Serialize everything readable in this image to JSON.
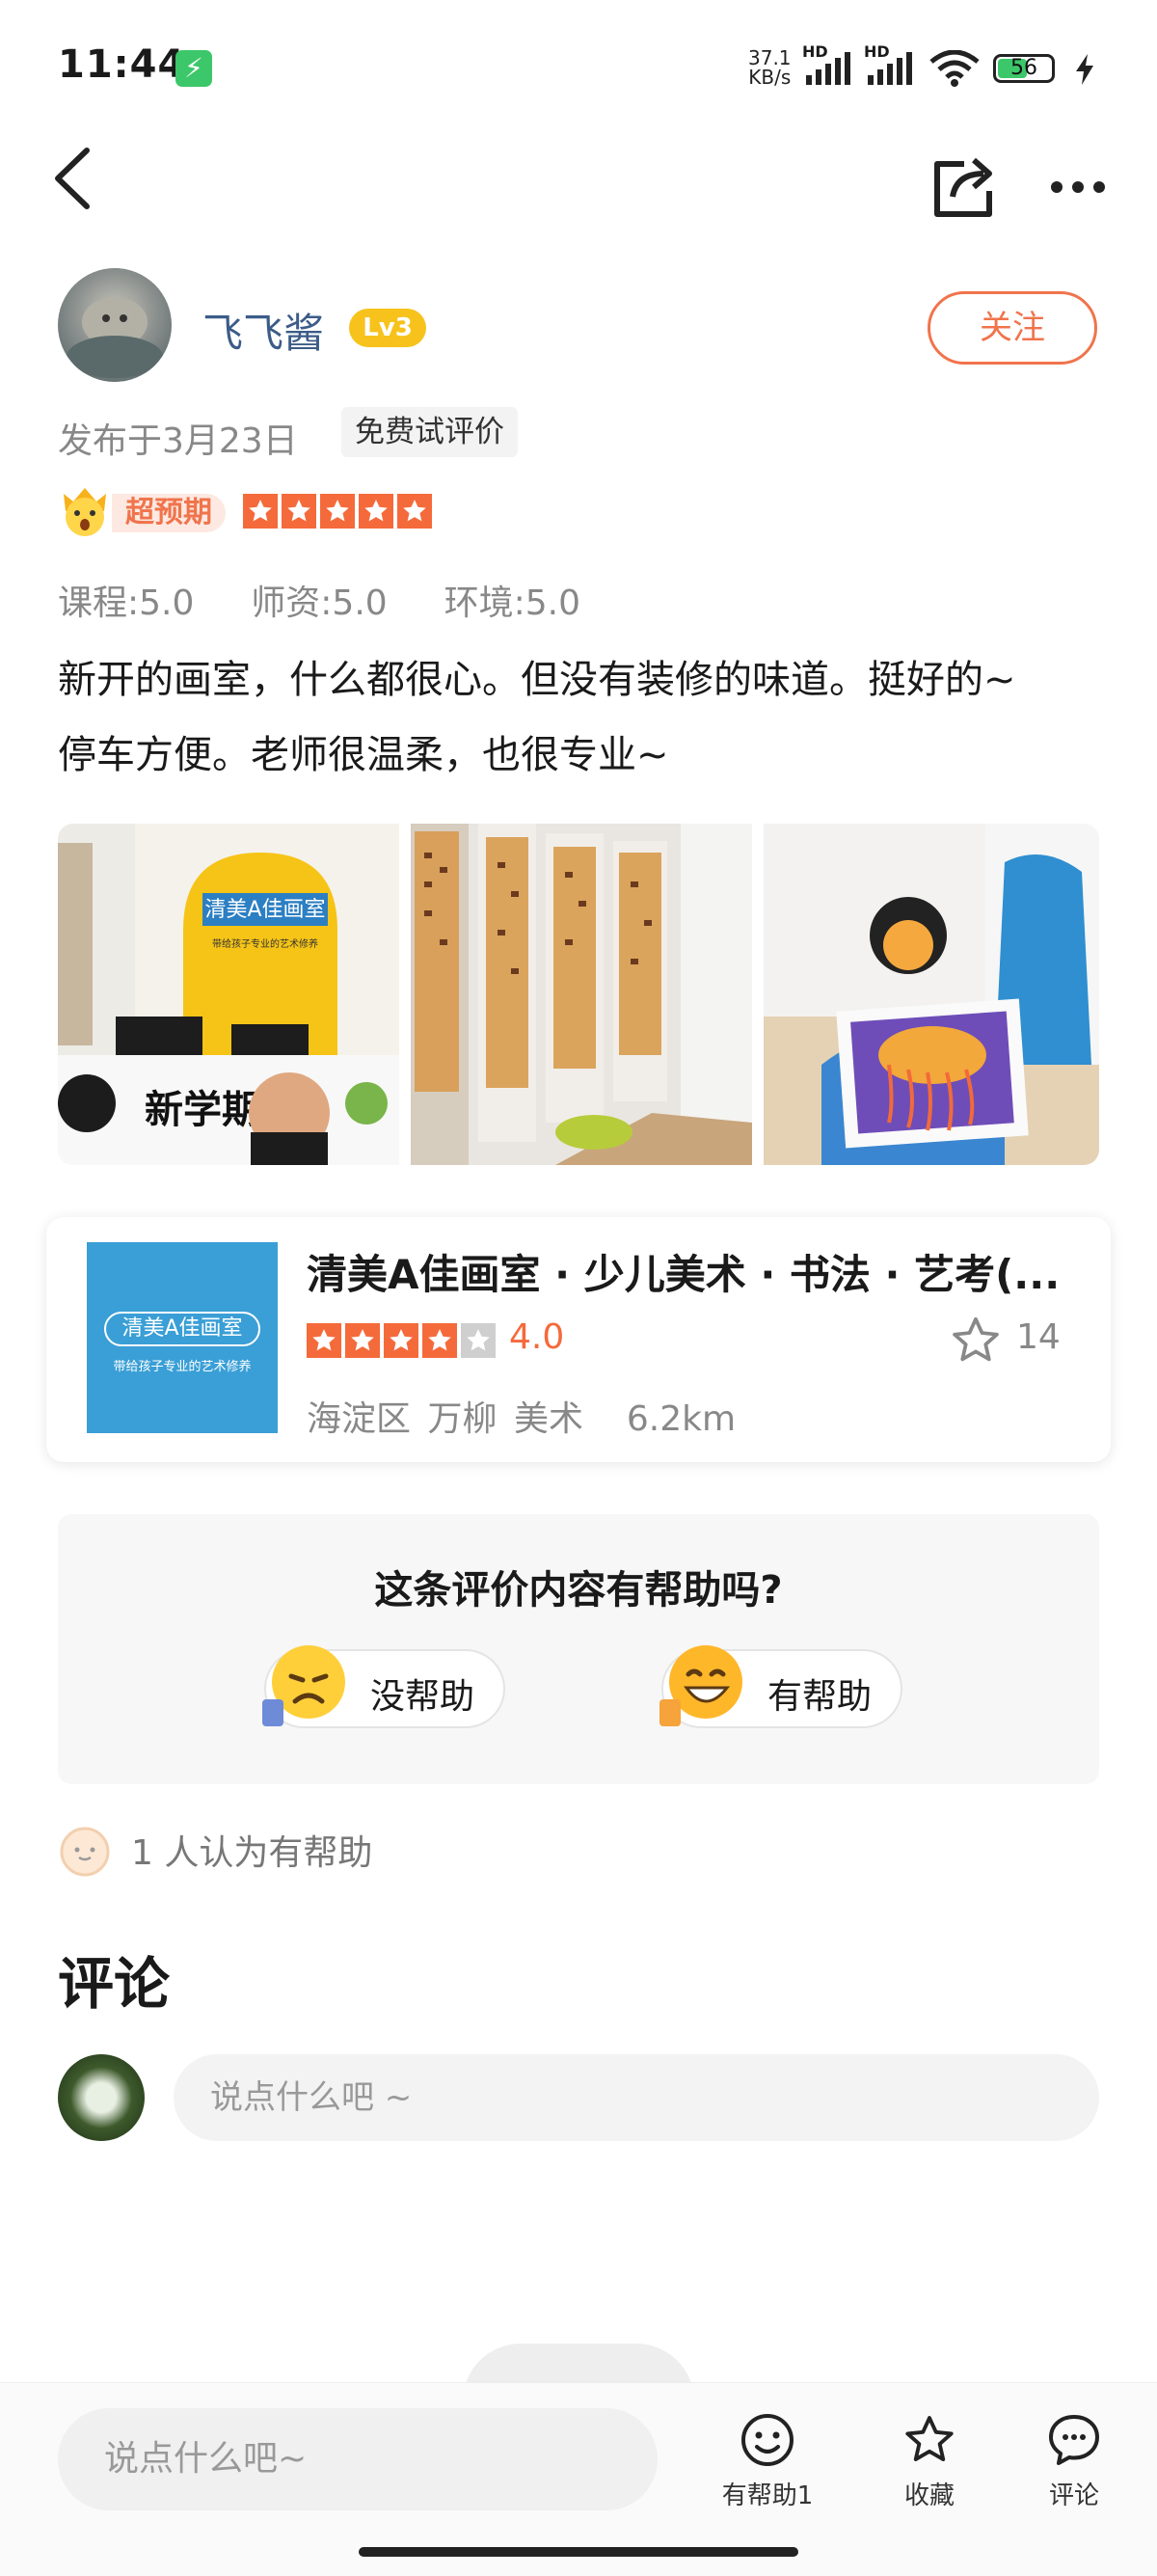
{
  "status_bar": {
    "time": "11:44",
    "charge_icon": "⚡",
    "net_speed_value": "37.1",
    "net_speed_unit": "KB/s",
    "signal1_label": "HD",
    "signal2_label": "HD",
    "battery_level": "56",
    "battery_fraction": 0.56
  },
  "header": {
    "back_icon": "chevron-left-icon",
    "share_icon": "share-icon",
    "more_icon": "more-icon"
  },
  "author": {
    "name": "飞飞酱",
    "level": "Lv3",
    "follow_label": "关注",
    "post_date": "发布于3月23日",
    "review_tag": "免费试评价"
  },
  "rating": {
    "badge_label": "超预期",
    "stars": 5
  },
  "scores": {
    "course": "课程:5.0",
    "teacher": "师资:5.0",
    "environment": "环境:5.0"
  },
  "review": {
    "text_line1": "新开的画室，什么都很心。但没有装修的味道。挺好的~",
    "text_line2": "停车方便。老师很温柔，也很专业~"
  },
  "photos": {
    "photo1_sign": "清美A佳画室",
    "photo1_subsign": "带给孩子专业的艺术修养",
    "photo1_board": "新学期"
  },
  "shop": {
    "name": "清美A佳画室 · 少儿美术 · 书法 · 艺考(...",
    "logo_text": "清美A佳画室",
    "logo_subtext": "带给孩子专业的艺术修养",
    "stars": 4,
    "rating": "4.0",
    "favorites": "14",
    "district": "海淀区",
    "area": "万柳",
    "category": "美术",
    "distance": "6.2km"
  },
  "helpful": {
    "question": "这条评价内容有帮助吗?",
    "not_helpful_label": "没帮助",
    "helpful_label": "有帮助",
    "count_text": "1 人认为有帮助"
  },
  "comments": {
    "title": "评论",
    "input_placeholder": "说点什么吧 ~"
  },
  "bottom_bar": {
    "input_placeholder": "说点什么吧~",
    "helpful_label": "有帮助1",
    "favorite_label": "收藏",
    "comment_label": "评论"
  },
  "colors": {
    "accent": "#f0744c",
    "star": "#f56a3b",
    "level_badge": "#f7c21b",
    "author_name": "#3c5c88",
    "logo_blue": "#3a9fd6"
  }
}
